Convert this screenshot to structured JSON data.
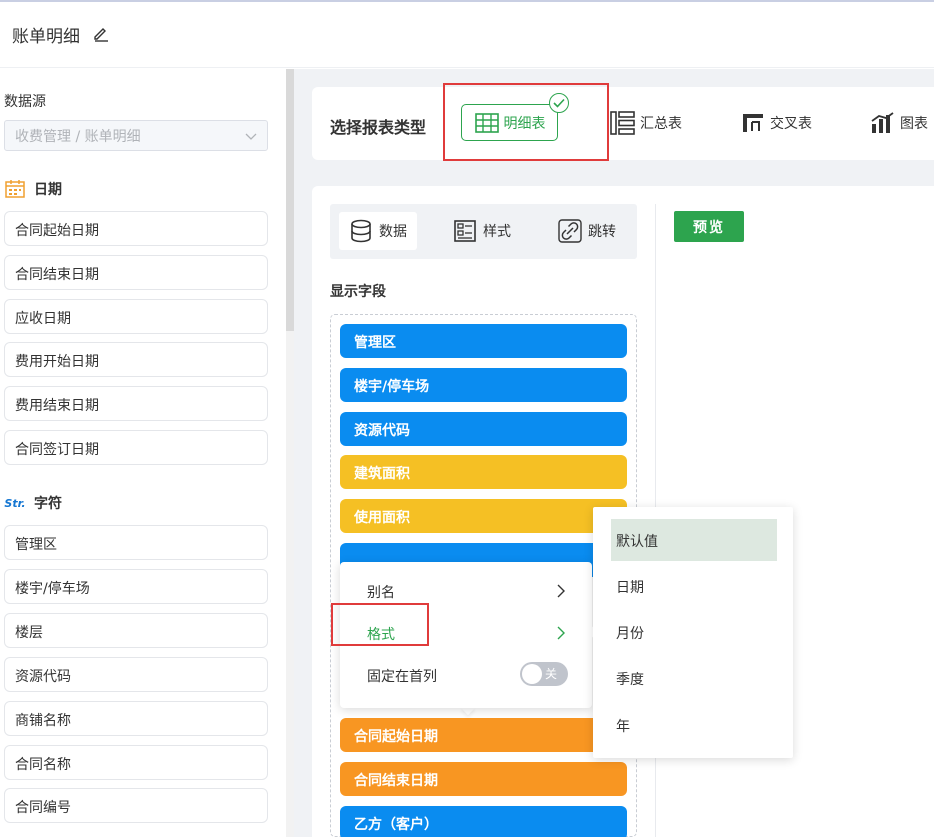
{
  "header": {
    "title": "账单明细"
  },
  "sidebar": {
    "datasource_label": "数据源",
    "datasource_value": "收费管理 / 账单明细",
    "date_group": {
      "title": "日期",
      "items": [
        "合同起始日期",
        "合同结束日期",
        "应收日期",
        "费用开始日期",
        "费用结束日期",
        "合同签订日期"
      ]
    },
    "string_group": {
      "icon_text": "Str.",
      "title": "字符",
      "items": [
        "管理区",
        "楼宇/停车场",
        "楼层",
        "资源代码",
        "商铺名称",
        "合同名称",
        "合同编号"
      ]
    }
  },
  "report_type": {
    "label": "选择报表类型",
    "options": [
      "明细表",
      "汇总表",
      "交叉表",
      "图表"
    ],
    "selected_index": 0
  },
  "config_tabs": [
    "数据",
    "样式",
    "跳转"
  ],
  "show_fields_label": "显示字段",
  "field_chips": [
    {
      "label": "管理区",
      "color": "#0a8cf0"
    },
    {
      "label": "楼宇/停车场",
      "color": "#0a8cf0"
    },
    {
      "label": "资源代码",
      "color": "#0a8cf0"
    },
    {
      "label": "建筑面积",
      "color": "#f5c024"
    },
    {
      "label": "使用面积",
      "color": "#f5c024"
    },
    {
      "label": "合同起始日期",
      "color": "#f89622"
    },
    {
      "label": "合同结束日期",
      "color": "#f89622"
    },
    {
      "label": "乙方（客户）",
      "color": "#0a8cf0"
    }
  ],
  "preview_button": "预览",
  "context_menu": {
    "alias": "别名",
    "format": "格式",
    "pin_first_col": "固定在首列",
    "toggle_label": "关"
  },
  "format_submenu": [
    "默认值",
    "日期",
    "月份",
    "季度",
    "年"
  ],
  "colors": {
    "accent": "#2da44e",
    "blue": "#0a8cf0",
    "yellow": "#f5c024",
    "orange": "#f89622",
    "highlight": "#e03b3b"
  }
}
